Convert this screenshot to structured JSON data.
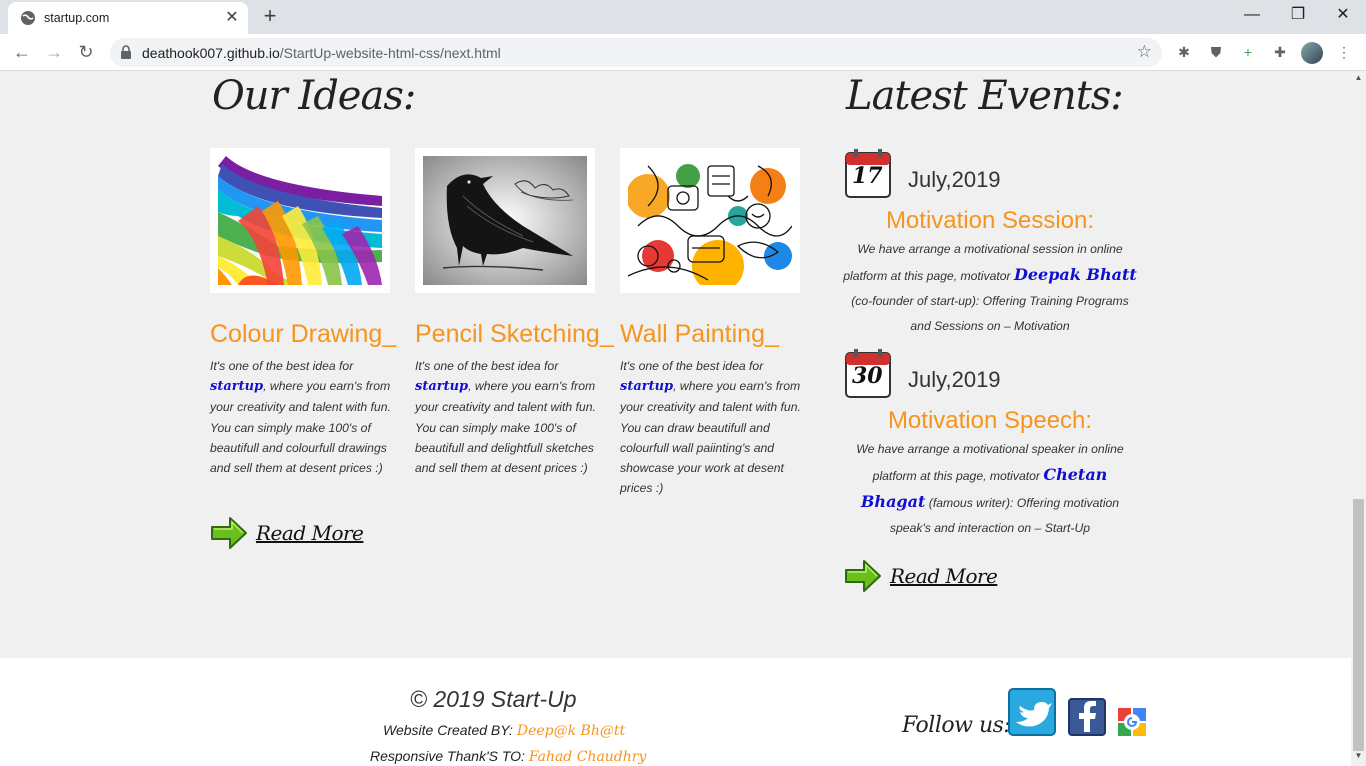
{
  "browser": {
    "tab_title": "startup.com",
    "url_host": "deathook007.github.io",
    "url_path": "/StartUp-website-html-css/next.html"
  },
  "ideas": {
    "heading": "Our Ideas:",
    "items": [
      {
        "title": "Colour Drawing_",
        "text_before": "It's one of the best idea for ",
        "brand": "startup",
        "text_after": ", where you earn's from your creativity and talent with fun. You can simply make 100's of beautifull and colourfull drawings and sell them at desent prices :)"
      },
      {
        "title": "Pencil Sketching_",
        "text_before": "It's one of the best idea for ",
        "brand": "startup",
        "text_after": ", where you earn's from your creativity and talent with fun. You can simply make 100's of beautifull and delightfull sketches and sell them at desent prices :)"
      },
      {
        "title": "Wall Painting_",
        "text_before": "It's one of the best idea for ",
        "brand": "startup",
        "text_after": ", where you earn's from your creativity and talent with fun. You can draw beautifull and colourfull wall paiinting's and showcase your work at desent prices :)"
      }
    ],
    "read_more": "Read More"
  },
  "events": {
    "heading": "Latest Events:",
    "items": [
      {
        "day": "17",
        "month": "July,2019",
        "title": "Motivation Session:",
        "text_before": "We have arrange a motivational session in online platform at this page, motivator ",
        "person": "Deepak Bhatt",
        "text_after": " (co-founder of start-up): Offering Training Programs and Sessions on – Motivation"
      },
      {
        "day": "30",
        "month": "July,2019",
        "title": "Motivation Speech:",
        "text_before": "We have arrange a motivational speaker in online platform at this page, motivator ",
        "person": "Chetan Bhagat",
        "text_after": " (famous writer): Offering motivation speak's and interaction on – Start-Up"
      }
    ],
    "read_more": "Read More"
  },
  "footer": {
    "copyright": "© 2019 Start-Up",
    "created_label": "Website Created BY: ",
    "created_by": "Deep@k Bh@tt",
    "thanks_label": "Responsive Thank'S TO: ",
    "thanks_to": "Fahad Chaudhry",
    "follow": "Follow us:"
  },
  "colors": {
    "accent": "#f7941d",
    "link_blue": "#1010d0",
    "page_bg": "#f0f0f0"
  }
}
